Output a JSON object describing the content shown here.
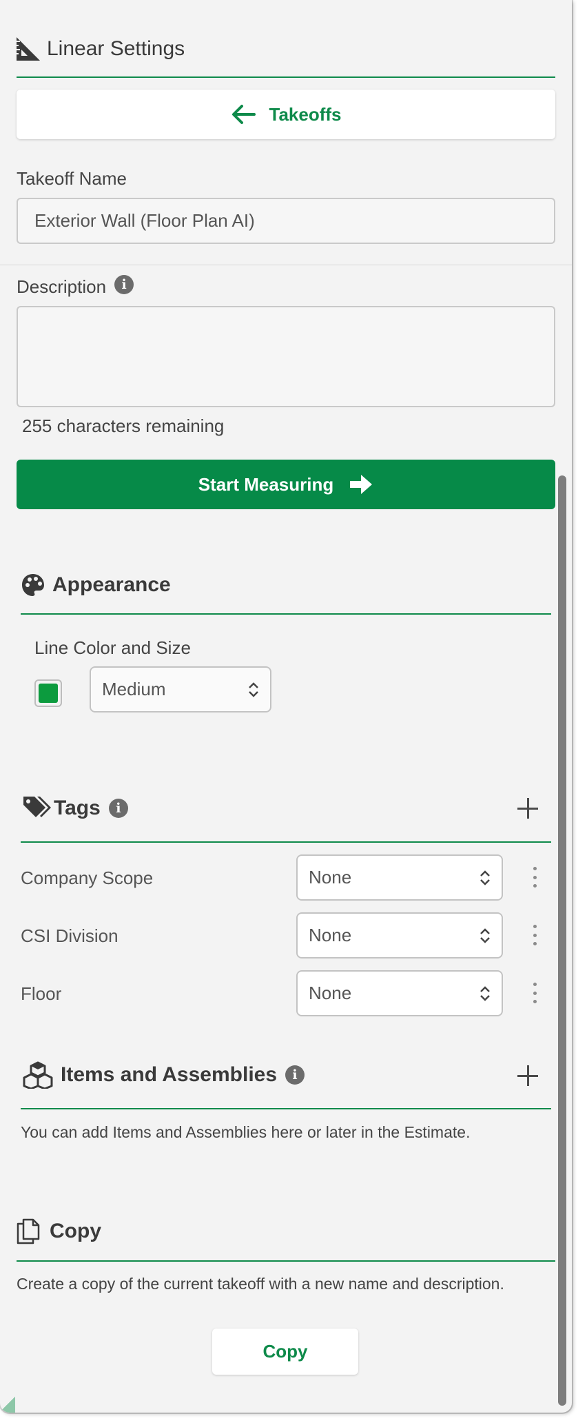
{
  "header": {
    "title": "Linear Settings",
    "icon": "ruler-triangle-icon"
  },
  "back_button": {
    "label": "Takeoffs",
    "icon": "arrow-left-icon"
  },
  "takeoff_name": {
    "label": "Takeoff Name",
    "value": "Exterior Wall (Floor Plan AI)"
  },
  "description": {
    "label": "Description",
    "value": "",
    "remaining": "255 characters remaining"
  },
  "start_button": {
    "label": "Start Measuring",
    "icon": "arrow-right-icon"
  },
  "appearance": {
    "title": "Appearance",
    "icon": "palette-icon",
    "line_label": "Line Color and Size",
    "color": "#0c9b3e",
    "size_value": "Medium"
  },
  "tags": {
    "title": "Tags",
    "icon": "tags-icon",
    "rows": [
      {
        "label": "Company Scope",
        "value": "None"
      },
      {
        "label": "CSI Division",
        "value": "None"
      },
      {
        "label": "Floor",
        "value": "None"
      }
    ]
  },
  "items": {
    "title": "Items and Assemblies",
    "icon": "boxes-icon",
    "hint": "You can add Items and Assemblies here or later in the Estimate."
  },
  "copy": {
    "title": "Copy",
    "icon": "copy-icon",
    "hint": "Create a copy of the current takeoff with a new name and description.",
    "button_label": "Copy"
  },
  "colors": {
    "accent": "#0e8a4a",
    "primary": "#068a48"
  }
}
